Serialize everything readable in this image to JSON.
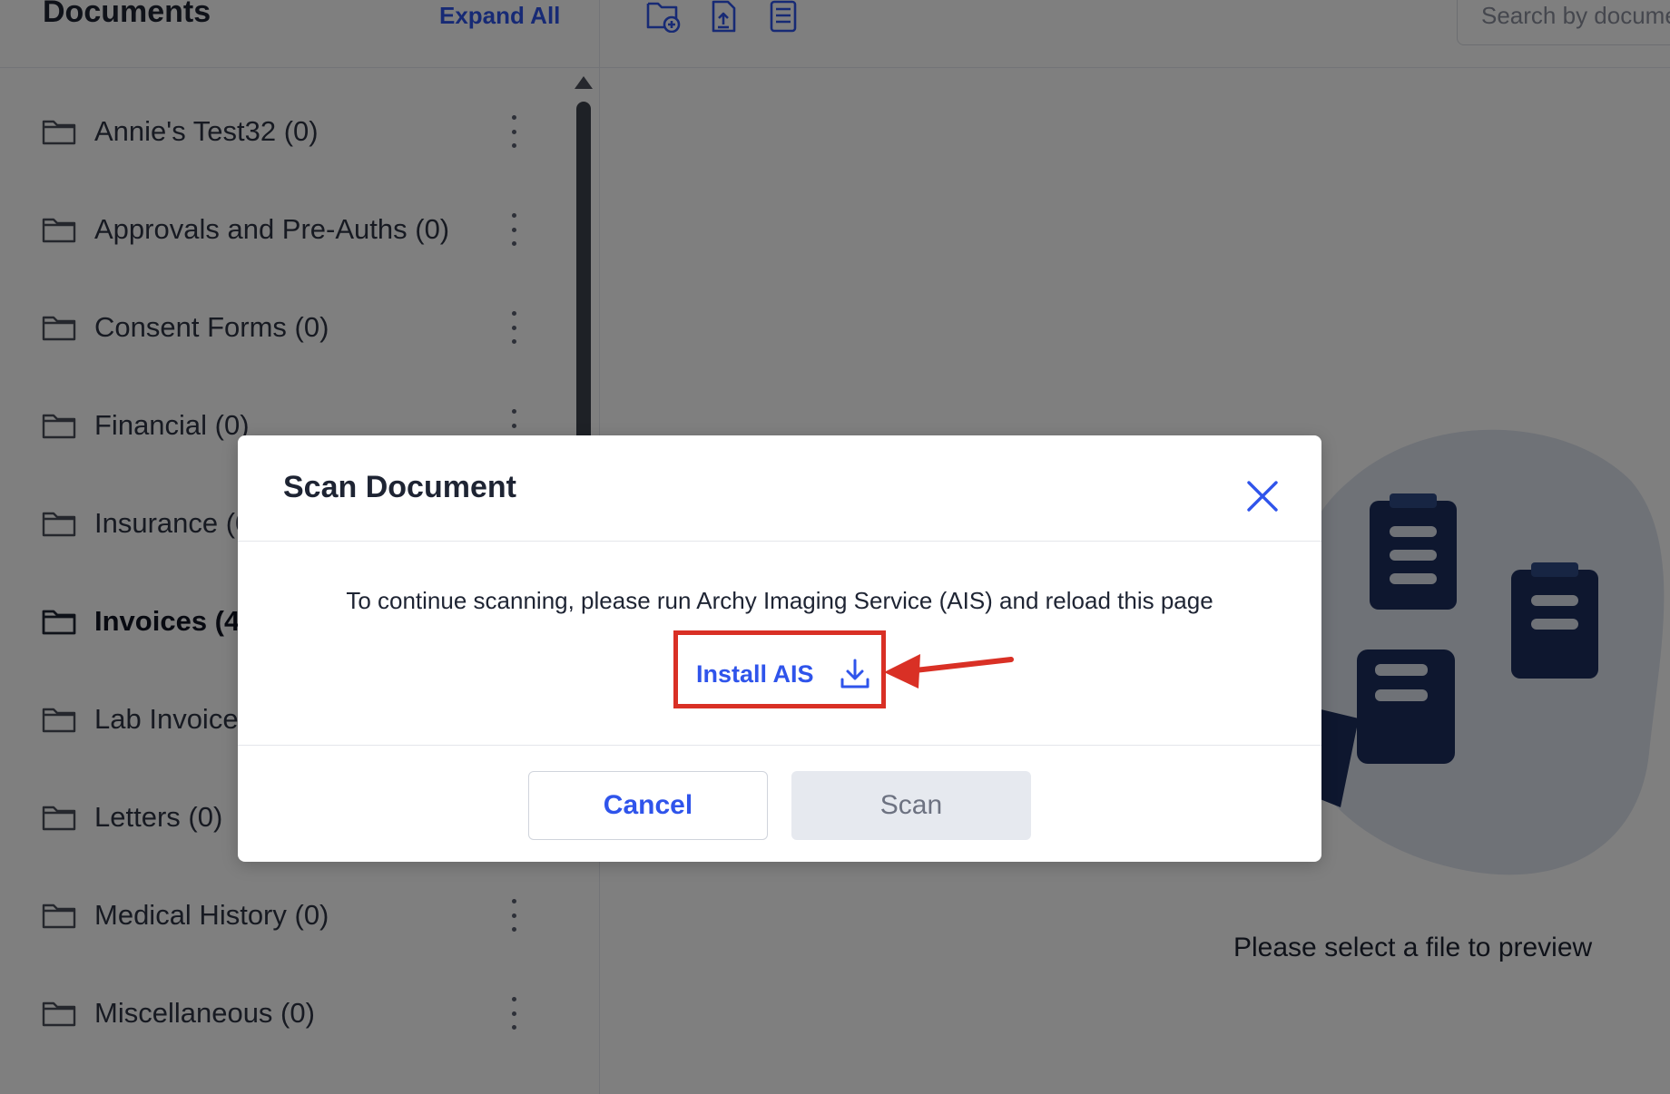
{
  "left_panel": {
    "title": "Documents",
    "expand_all": "Expand All",
    "folders": [
      {
        "label": "Annie's Test32 (0)"
      },
      {
        "label": "Approvals and Pre-Auths (0)"
      },
      {
        "label": "Consent Forms (0)"
      },
      {
        "label": "Financial (0)"
      },
      {
        "label": "Insurance (0)"
      },
      {
        "label": "Invoices (41)"
      },
      {
        "label": "Lab Invoices (0)"
      },
      {
        "label": "Letters (0)"
      },
      {
        "label": "Medical History (0)"
      },
      {
        "label": "Miscellaneous (0)"
      }
    ]
  },
  "toolbar": {
    "icons": [
      "new-folder-icon",
      "upload-document-icon",
      "scan-document-icon"
    ],
    "search_placeholder": "Search by document"
  },
  "preview": {
    "empty_text": "Please select a file to preview"
  },
  "modal": {
    "title": "Scan Document",
    "message": "To continue scanning, please run Archy Imaging Service (AIS) and reload this page",
    "install_label": "Install AIS",
    "cancel_label": "Cancel",
    "scan_label": "Scan"
  },
  "colors": {
    "accent": "#2f54eb",
    "highlight": "#d93025",
    "illustration_navy": "#1c2f5e",
    "illustration_blob": "#dfe4ef"
  }
}
